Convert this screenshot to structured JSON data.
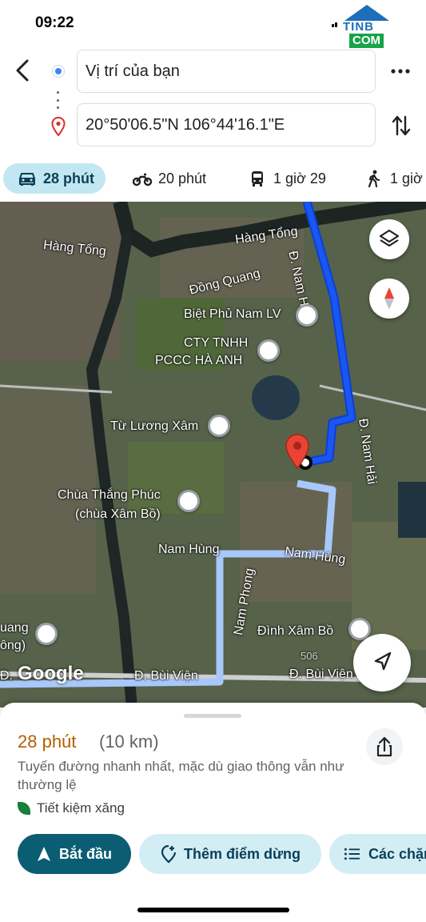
{
  "status_bar": {
    "time": "09:22"
  },
  "watermark": {
    "text_top": "TINB",
    "text_com": "COM"
  },
  "directions": {
    "back_icon": "back-arrow-icon",
    "origin": "Vị trí của bạn",
    "destination": "20°50'06.5\"N 106°44'16.1\"E",
    "more_icon": "more-horizontal-icon",
    "swap_icon": "swap-vertical-icon"
  },
  "modes": [
    {
      "name": "car",
      "icon": "car-icon",
      "label": "28 phút",
      "active": true
    },
    {
      "name": "motorbike",
      "icon": "motorbike-icon",
      "label": "20 phút",
      "active": false
    },
    {
      "name": "transit",
      "icon": "bus-icon",
      "label": "1 giờ 29",
      "active": false
    },
    {
      "name": "walk",
      "icon": "walk-icon",
      "label": "1 giờ",
      "active": false
    }
  ],
  "map": {
    "labels": {
      "hang_tong_1": "Hàng Tổng",
      "hang_tong_2": "Hàng Tổng",
      "dong_quang": "Đồng Quang",
      "nam_hai_1": "Đ. Nam Hải",
      "nam_hai_2": "Đ. Nam Hải",
      "nam_hung_1": "Nam Hùng",
      "nam_hung_2": "Nam Hùng",
      "nam_phong": "Nam Phong",
      "bui_vien_1": "Đ. Bùi Viện",
      "bui_vien_2": "Đ. Bùi Viện",
      "bui_vien_prefix": "Đ.",
      "road_506": "506"
    },
    "pois": {
      "biet_phu": "Biệt Phủ Nam LV",
      "cty_line1": "CTY TNHH",
      "cty_line2": "PCCC HÀ ANH",
      "tu_luong_xam": "Từ Lương Xâm",
      "chua_line1": "Chùa Thắng Phúc",
      "chua_line2": "(chùa Xâm Bồ)",
      "dinh_xam_bo": "Đình Xâm Bồ",
      "left_partial_1": "uang",
      "left_partial_2": "ông)"
    },
    "google_logo": "Google",
    "route_color": "#1a57f0",
    "alt_route_color": "#a8c7fa",
    "pin_color": "#ea4335"
  },
  "route": {
    "time": "28 phút",
    "distance": "(10 km)",
    "description": "Tuyến đường nhanh nhất, mặc dù giao thông vẫn như thường lệ",
    "eco_label": "Tiết kiệm xăng"
  },
  "actions": {
    "start": "Bắt đầu",
    "add_stop": "Thêm điểm dừng",
    "steps": "Các chặng"
  }
}
